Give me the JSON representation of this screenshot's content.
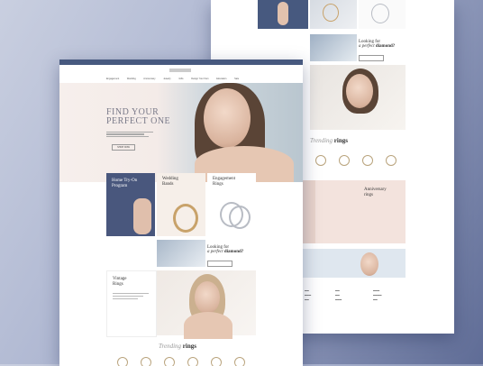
{
  "hero": {
    "title_line1": "FIND YOUR",
    "title_line2": "PERFECT ONE",
    "cta": "SHOP NOW"
  },
  "nav": [
    "Engagement",
    "Wedding",
    "Anniversary",
    "Jewelry",
    "Gifts",
    "Design Your Own",
    "Education",
    "Sale"
  ],
  "cards": {
    "home_try_on": {
      "line1": "Home Try-On",
      "line2": "Program"
    },
    "wedding_bands": {
      "line1": "Wedding",
      "line2": "Bands"
    },
    "engagement_rings": {
      "line1": "Engagement",
      "line2": "Rings"
    },
    "vintage_rings": {
      "line1": "Vintage",
      "line2": "Rings"
    },
    "anniversary_rings": {
      "line1": "Anniversary",
      "line2": "rings"
    }
  },
  "promo": {
    "line1": "Looking for",
    "line2_italic": "a perfect",
    "line2_bold": "diamond?"
  },
  "trending": {
    "italic": "Trending",
    "bold": "rings"
  },
  "colors": {
    "bar": "#47597f",
    "card_blue": "#49577d",
    "accent_gold": "#c8a26a"
  }
}
